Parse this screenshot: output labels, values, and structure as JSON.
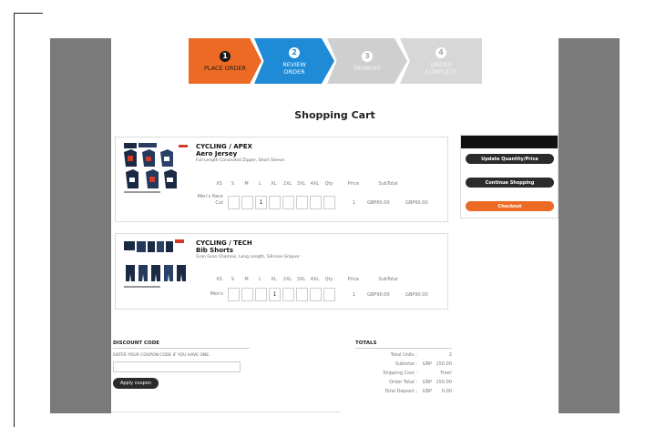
{
  "steps": [
    {
      "num": "1",
      "label": "PLACE ORDER"
    },
    {
      "num": "2",
      "label": "REVIEW ORDER"
    },
    {
      "num": "3",
      "label": "PAYMENT"
    },
    {
      "num": "4",
      "label": "ORDER COMPLETE"
    }
  ],
  "cart": {
    "title": "Shopping Cart",
    "size_headers": [
      "XS",
      "S",
      "M",
      "L",
      "XL",
      "2XL",
      "3XL",
      "4XL",
      "Qty",
      "Price",
      "SubTotal"
    ],
    "items": [
      {
        "category": "CYCLING / APEX",
        "name": "Aero Jersey",
        "description": "Full Length Concealed Zipper, Short Sleeve",
        "row_label": "Men's Race Cut",
        "sizes": [
          "",
          "",
          "1",
          "",
          "",
          "",
          "",
          ""
        ],
        "qty": "1",
        "price": "GBP60.00",
        "subtotal": "GBP60.00"
      },
      {
        "category": "CYCLING / TECH",
        "name": "Bib Shorts",
        "description": "Gran Gran Chamois, Long Length, Silicone Gripper",
        "row_label": "Men's",
        "sizes": [
          "",
          "",
          "",
          "1",
          "",
          "",
          "",
          ""
        ],
        "qty": "1",
        "price": "GBP90.00",
        "subtotal": "GBP90.00"
      }
    ]
  },
  "side": {
    "update_label": "Update Quantity/Price",
    "continue_label": "Continue Shopping",
    "checkout_label": "Checkout"
  },
  "discount": {
    "title": "DISCOUNT CODE",
    "hint": "ENTER YOUR COUPON CODE IF YOU HAVE ONE.",
    "apply_label": "Apply coupon"
  },
  "totals": {
    "title": "TOTALS",
    "rows": [
      {
        "label": "Total Units :",
        "currency": "",
        "value": "2"
      },
      {
        "label": "Subtotal :",
        "currency": "GBP",
        "value": "150.00"
      },
      {
        "label": "Shipping Cost :",
        "currency": "",
        "value": "Free!"
      },
      {
        "label": "Order Total :",
        "currency": "GBP",
        "value": "150.00"
      },
      {
        "label": "Total Deposit :",
        "currency": "GBP",
        "value": "0.00"
      }
    ]
  },
  "colors": {
    "accent_orange": "#ec6a24",
    "accent_blue": "#1f8ad6",
    "gutter_gray": "#7a7a7a"
  }
}
